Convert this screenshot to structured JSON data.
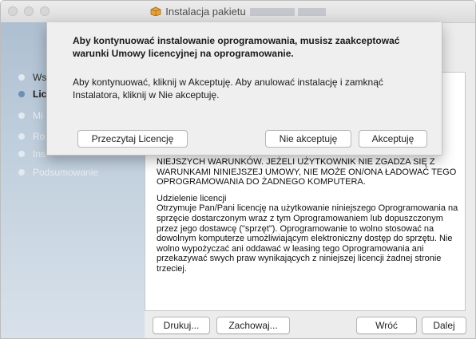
{
  "window": {
    "title": "Instalacja pakietu"
  },
  "sidebar": {
    "items": [
      {
        "label": "Ws"
      },
      {
        "label": "Lic"
      },
      {
        "label": "Mi"
      },
      {
        "label": "Ro"
      },
      {
        "label": "Ins"
      },
      {
        "label": "Podsumowanie"
      }
    ]
  },
  "license": {
    "paragraphs": [
      "NIEJSZYCH WARUNKÓW. JEŻELI UŻYTKOWNIK NIE ZGADZA SIĘ Z WARUNKAMI NINIEJSZEJ UMOWY, NIE MOŻE ON/ONA ŁADOWAĆ TEGO OPROGRAMOWANIA DO ŻADNEGO KOMPUTERA.",
      "Udzielenie licencji\nOtrzymuje Pan/Pani licencję na użytkowanie niniejszego Oprogramowania na sprzęcie dostarczonym wraz z tym Oprogramowaniem lub dopuszczonym przez jego dostawcę (\"sprzęt\"). Oprogramowanie to wolno stosować na dowolnym komputerze umożliwiającym elektroniczny dostęp do sprzętu. Nie wolno wypożyczać ani oddawać w leasing tego Oprogramowania ani przekazywać swych praw wynikających z niniejszej licencji żadnej stronie trzeciej."
    ]
  },
  "footer": {
    "print_label": "Drukuj...",
    "save_label": "Zachowaj...",
    "back_label": "Wróć",
    "continue_label": "Dalej"
  },
  "sheet": {
    "title": "Aby kontynuować instalowanie oprogramowania, musisz zaakceptować warunki Umowy licencyjnej na oprogramowanie.",
    "message": "Aby kontynuować, kliknij w Akceptuję. Aby anulować instalację i zamknąć Instalatora, kliknij w Nie akceptuję.",
    "read_label": "Przeczytaj Licencję",
    "decline_label": "Nie akceptuję",
    "accept_label": "Akceptuję"
  }
}
